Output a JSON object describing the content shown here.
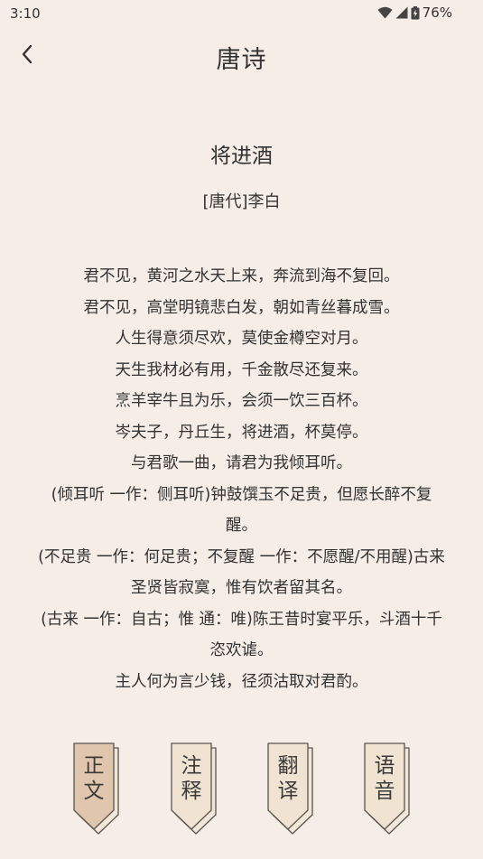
{
  "status_bar": {
    "time": "3:10",
    "battery": "76%",
    "icons": [
      "wifi-icon",
      "signal-icon",
      "battery-icon"
    ]
  },
  "header": {
    "title": "唐诗",
    "back_icon": "chevron-left-icon"
  },
  "poem": {
    "title": "将进酒",
    "author": "[唐代]李白",
    "lines": [
      "君不见，黄河之水天上来，奔流到海不复回。",
      "君不见，高堂明镜悲白发，朝如青丝暮成雪。",
      "人生得意须尽欢，莫使金樽空对月。",
      "天生我材必有用，千金散尽还复来。",
      "烹羊宰牛且为乐，会须一饮三百杯。",
      "岑夫子，丹丘生，将进酒，杯莫停。",
      "与君歌一曲，请君为我倾耳听。",
      "(倾耳听 一作：侧耳听)钟鼓馔玉不足贵，但愿长醉不复醒。",
      "(不足贵 一作：何足贵；不复醒 一作：不愿醒/不用醒)古来圣贤皆寂寞，惟有饮者留其名。",
      "(古来 一作：自古；惟 通：唯)陈王昔时宴平乐，斗酒十千恣欢谑。",
      "主人何为言少钱，径须沽取对君酌。"
    ]
  },
  "tabs": [
    {
      "label": "正文",
      "selected": true
    },
    {
      "label": "注释",
      "selected": false
    },
    {
      "label": "翻译",
      "selected": false
    },
    {
      "label": "语音",
      "selected": false
    }
  ],
  "colors": {
    "background": "#f5ede6",
    "tab_selected": "#dfc6ac",
    "tab_normal": "#f1e3d2",
    "tab_outline": "#5a5450"
  }
}
